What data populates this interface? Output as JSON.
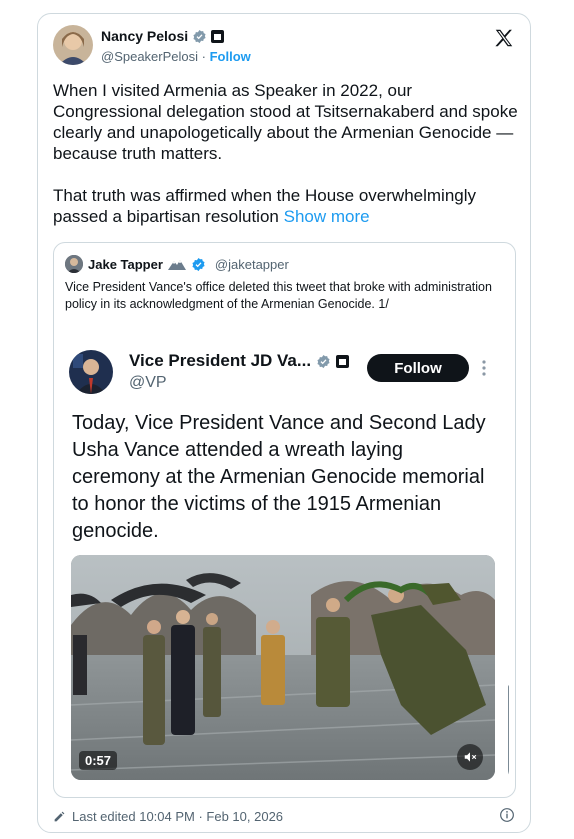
{
  "tweet": {
    "author_name": "Nancy Pelosi",
    "author_handle": "@SpeakerPelosi",
    "separator": " · ",
    "follow_label": "Follow",
    "paragraph1": "When I visited Armenia as Speaker in 2022, our Congressional delegation stood at Tsitsernakaberd and spoke clearly and unapologetically about the Armenian Genocide — because truth matters.",
    "paragraph2": "That truth was affirmed when the House overwhelmingly passed a bipartisan resolution",
    "show_more_label": "Show more",
    "footer_text": "Last edited 10:04 PM · Feb 10, 2026"
  },
  "quote": {
    "author_name": "Jake Tapper",
    "author_handle": "@jaketapper",
    "text": "Vice President Vance's office deleted this tweet that broke with administration policy in its acknowledgment of the Armenian Genocide. 1/"
  },
  "embedded": {
    "author_name": "Vice President JD Va...",
    "author_handle": "@VP",
    "follow_label": "Follow",
    "text": "Today, Vice President Vance and Second Lady Usha Vance attended a wreath laying ceremony at the Armenian Genocide memorial to honor the victims of the 1915 Armenian genocide.",
    "video_duration": "0:57"
  },
  "colors": {
    "accent": "#1d9bf0",
    "text_primary": "#0f1419",
    "text_secondary": "#536471",
    "border": "#cfd9de"
  },
  "icons": {
    "verified": "verified-badge-icon",
    "government": "government-badge-icon",
    "x_logo": "x-logo-icon",
    "mute": "mute-icon",
    "edit": "pencil-icon",
    "info": "info-icon"
  }
}
